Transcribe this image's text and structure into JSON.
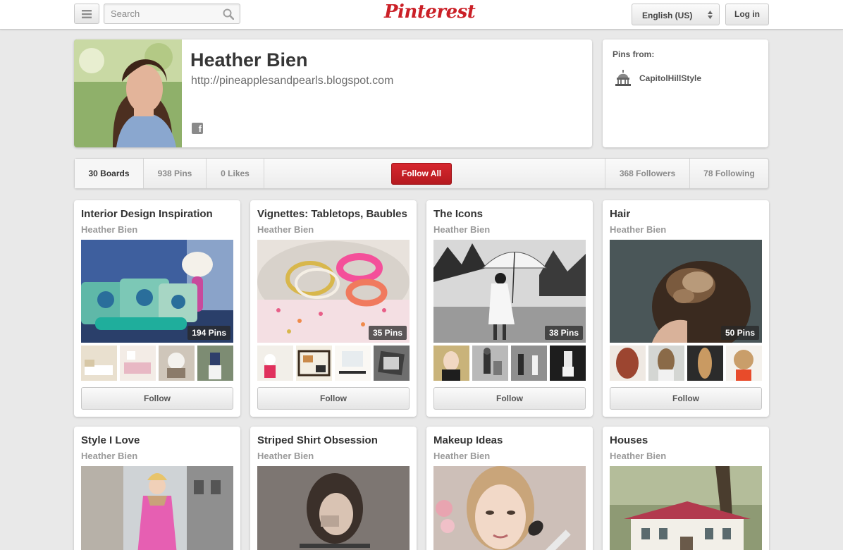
{
  "header": {
    "search_placeholder": "Search",
    "logo": "Pinterest",
    "language": "English (US)",
    "login_label": "Log in"
  },
  "profile": {
    "name": "Heather Bien",
    "url": "http://pineapplesandpearls.blogspot.com",
    "social_icon": "facebook-icon"
  },
  "pins_from": {
    "title": "Pins from:",
    "source": "CapitolHillStyle"
  },
  "stats": {
    "boards": "30 Boards",
    "pins": "938 Pins",
    "likes": "0 Likes",
    "follow_all": "Follow All",
    "followers": "368 Followers",
    "following": "78 Following"
  },
  "boards": [
    {
      "title": "Interior Design Inspiration",
      "owner": "Heather Bien",
      "pins": "194 Pins",
      "follow": "Follow"
    },
    {
      "title": "Vignettes: Tabletops, Baubles",
      "owner": "Heather Bien",
      "pins": "35 Pins",
      "follow": "Follow"
    },
    {
      "title": "The Icons",
      "owner": "Heather Bien",
      "pins": "38 Pins",
      "follow": "Follow"
    },
    {
      "title": "Hair",
      "owner": "Heather Bien",
      "pins": "50 Pins",
      "follow": "Follow"
    },
    {
      "title": "Style I Love",
      "owner": "Heather Bien"
    },
    {
      "title": "Striped Shirt Obsession",
      "owner": "Heather Bien"
    },
    {
      "title": "Makeup Ideas",
      "owner": "Heather Bien"
    },
    {
      "title": "Houses",
      "owner": "Heather Bien"
    }
  ],
  "colors": {
    "brand_red": "#cb2027",
    "background": "#e9e9e9"
  }
}
